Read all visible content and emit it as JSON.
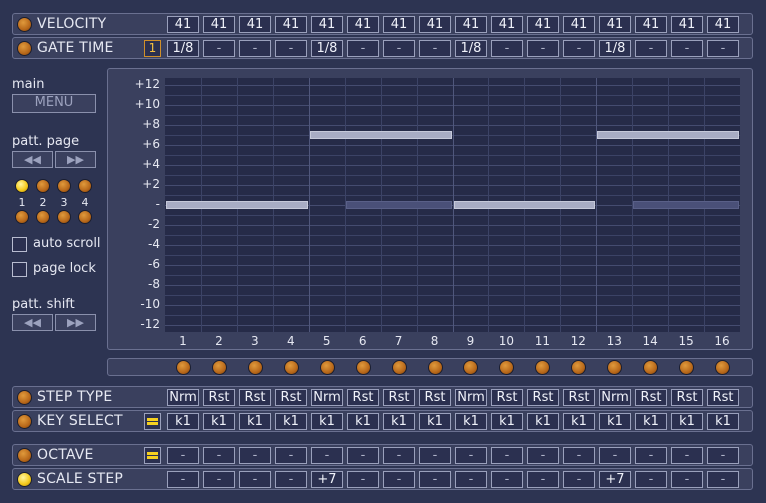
{
  "rows": {
    "velocity": {
      "label": "VELOCITY",
      "led_on": false,
      "values": [
        "41",
        "41",
        "41",
        "41",
        "41",
        "41",
        "41",
        "41",
        "41",
        "41",
        "41",
        "41",
        "41",
        "41",
        "41",
        "41"
      ]
    },
    "gate_time": {
      "label": "GATE TIME",
      "led_on": false,
      "button": "1",
      "values": [
        "1/8",
        "-",
        "-",
        "-",
        "1/8",
        "-",
        "-",
        "-",
        "1/8",
        "-",
        "-",
        "-",
        "1/8",
        "-",
        "-",
        "-"
      ]
    },
    "step_type": {
      "label": "STEP TYPE",
      "led_on": false,
      "values": [
        "Nrm",
        "Rst",
        "Rst",
        "Rst",
        "Nrm",
        "Rst",
        "Rst",
        "Rst",
        "Nrm",
        "Rst",
        "Rst",
        "Rst",
        "Nrm",
        "Rst",
        "Rst",
        "Rst"
      ]
    },
    "key_select": {
      "label": "KEY SELECT",
      "led_on": false,
      "values": [
        "k1",
        "k1",
        "k1",
        "k1",
        "k1",
        "k1",
        "k1",
        "k1",
        "k1",
        "k1",
        "k1",
        "k1",
        "k1",
        "k1",
        "k1",
        "k1"
      ]
    },
    "octave": {
      "label": "OCTAVE",
      "led_on": false,
      "values": [
        "-",
        "-",
        "-",
        "-",
        "-",
        "-",
        "-",
        "-",
        "-",
        "-",
        "-",
        "-",
        "-",
        "-",
        "-",
        "-"
      ]
    },
    "scale_step": {
      "label": "SCALE STEP",
      "led_on": true,
      "values": [
        "-",
        "-",
        "-",
        "-",
        "+7",
        "-",
        "-",
        "-",
        "-",
        "-",
        "-",
        "-",
        "+7",
        "-",
        "-",
        "-"
      ]
    }
  },
  "sidebar": {
    "main_label": "main",
    "menu_button": "MENU",
    "patt_page_label": "patt. page",
    "prev_arrow": "◀◀",
    "next_arrow": "▶▶",
    "page_numbers": [
      "1",
      "2",
      "3",
      "4"
    ],
    "active_page": 1,
    "auto_scroll_label": "auto scroll",
    "page_lock_label": "page lock",
    "auto_scroll_checked": false,
    "page_lock_checked": false,
    "patt_shift_label": "patt. shift"
  },
  "chart_data": {
    "type": "bar",
    "y_ticks": [
      "+12",
      "+10",
      "+8",
      "+6",
      "+4",
      "+2",
      "-",
      "-2",
      "-4",
      "-6",
      "-8",
      "-10",
      "-12"
    ],
    "ylim": [
      -12,
      12
    ],
    "x_ticks": [
      "1",
      "2",
      "3",
      "4",
      "5",
      "6",
      "7",
      "8",
      "9",
      "10",
      "11",
      "12",
      "13",
      "14",
      "15",
      "16"
    ],
    "notes": [
      {
        "step_start": 1,
        "step_end": 4,
        "value": 0,
        "style": "bright"
      },
      {
        "step_start": 5,
        "step_end": 8,
        "value": 7,
        "style": "bright"
      },
      {
        "step_start": 6,
        "step_end": 8,
        "value": 0,
        "style": "dim"
      },
      {
        "step_start": 9,
        "step_end": 12,
        "value": 0,
        "style": "bright"
      },
      {
        "step_start": 13,
        "step_end": 16,
        "value": 7,
        "style": "bright"
      },
      {
        "step_start": 14,
        "step_end": 16,
        "value": 0,
        "style": "dim"
      }
    ]
  },
  "step_leds": 16,
  "colors": {
    "background": "#2d3452",
    "led_orange": "#c87420",
    "led_yellow": "#f5cc20"
  }
}
